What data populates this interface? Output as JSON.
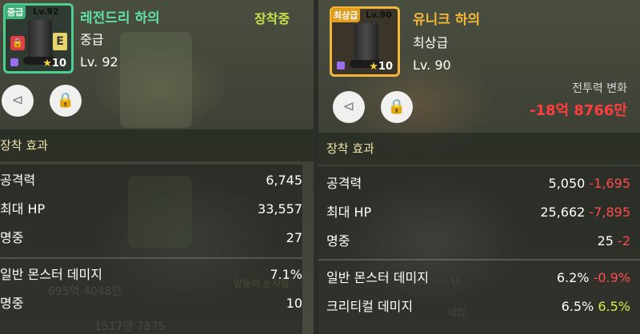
{
  "background_text": {
    "amount": "695억 4048만",
    "name": "앙동이 눈사람",
    "bottom_amount": "1517만 7875",
    "right_ghost_1": "난",
    "right_ghost_2": "네임"
  },
  "left_item": {
    "grade_tag": "중급",
    "level_tag": "Lv.92",
    "name": "레전드리 하의",
    "grade": "중급",
    "level": "Lv. 92",
    "equip_status": "장착중",
    "star_force": "10",
    "e_badge": "E",
    "name_color": "#5fe1a5",
    "section_title": "장착 효과",
    "stats": [
      {
        "label": "공격력",
        "value": "6,745"
      },
      {
        "label": "최대 HP",
        "value": "33,557"
      },
      {
        "label": "명중",
        "value": "27"
      },
      {
        "label": "일반 몬스터 데미지",
        "value": "7.1%"
      },
      {
        "label": "명중",
        "value": "10"
      }
    ]
  },
  "right_item": {
    "grade_tag": "최상급",
    "level_tag": "Lv.90",
    "name": "유니크 하의",
    "grade": "최상급",
    "level": "Lv. 90",
    "star_force": "10",
    "name_color": "#f6b93b",
    "power_change_label": "전투력 변화",
    "power_change_value": "-18억 8766만",
    "section_title": "장착 효과",
    "stats": [
      {
        "label": "공격력",
        "value": "5,050",
        "diff": "-1,695",
        "diff_type": "neg"
      },
      {
        "label": "최대 HP",
        "value": "25,662",
        "diff": "-7,895",
        "diff_type": "neg"
      },
      {
        "label": "명중",
        "value": "25",
        "diff": "-2",
        "diff_type": "neg"
      },
      {
        "label": "일반 몬스터 데미지",
        "value": "6.2%",
        "diff": "-0.9%",
        "diff_type": "neg"
      },
      {
        "label": "크리티컬 데미지",
        "value": "6.5%",
        "diff": "6.5%",
        "diff_type": "pos"
      }
    ]
  },
  "icons": {
    "share": "share-icon",
    "lock": "lock-icon",
    "star": "star-icon"
  }
}
